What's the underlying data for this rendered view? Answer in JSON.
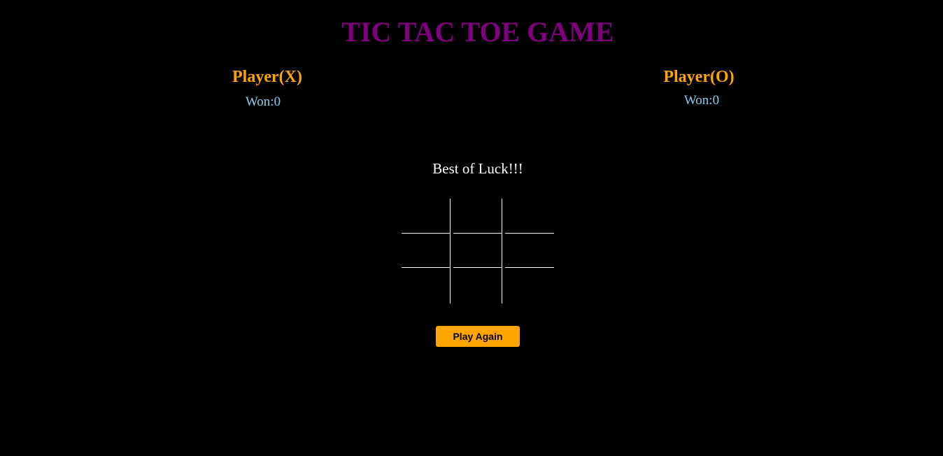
{
  "title": "TIC TAC TOE GAME",
  "players": {
    "x": {
      "name": "Player(X)",
      "won": "Won:0"
    },
    "o": {
      "name": "Player(O)",
      "won": "Won:0"
    }
  },
  "message": "Best of Luck!!!",
  "board": [
    "",
    "",
    "",
    "",
    "",
    "",
    "",
    "",
    ""
  ],
  "play_again_label": "Play Again",
  "colors": {
    "background": "#000000",
    "title": "#800080",
    "player_name": "#FFA500",
    "won": "#87CEEB",
    "grid": "#FFFFFF",
    "button": "#FFA500"
  }
}
